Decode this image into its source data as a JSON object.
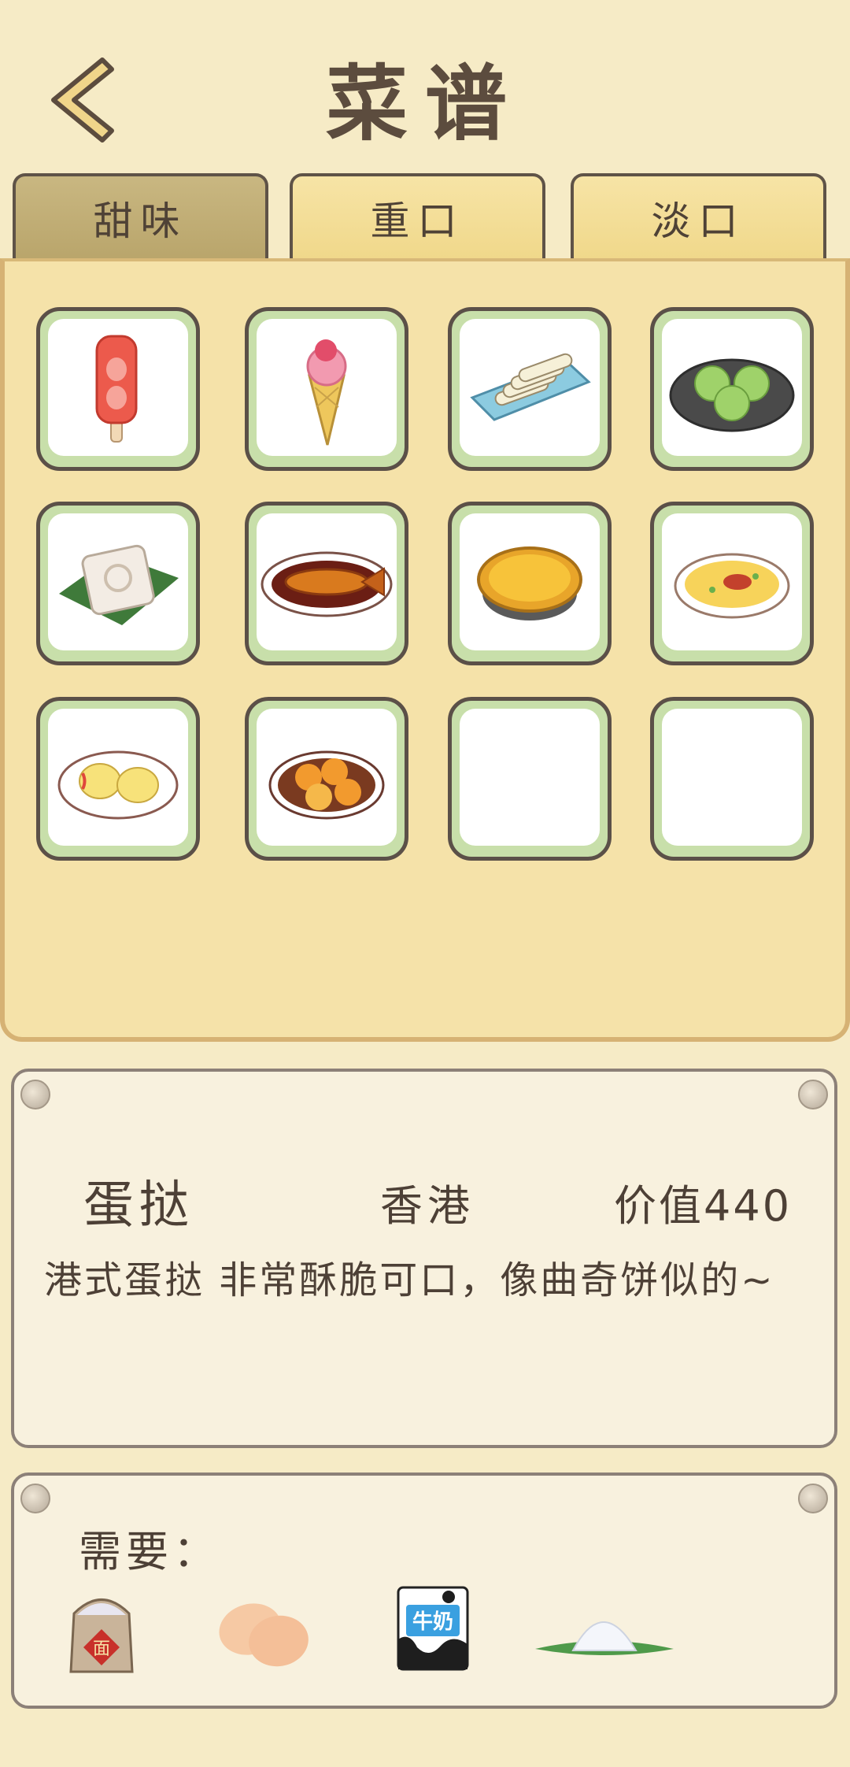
{
  "header": {
    "title": "菜谱"
  },
  "tabs": [
    {
      "label": "甜味",
      "active": true
    },
    {
      "label": "重口",
      "active": false
    },
    {
      "label": "淡口",
      "active": false
    }
  ],
  "recipes": [
    {
      "icon": "strawberry-popsicle-icon"
    },
    {
      "icon": "ice-cream-cone-icon"
    },
    {
      "icon": "rolled-snacks-icon"
    },
    {
      "icon": "green-dumplings-icon"
    },
    {
      "icon": "square-cake-icon"
    },
    {
      "icon": "braised-fish-icon"
    },
    {
      "icon": "egg-tart-icon"
    },
    {
      "icon": "omelette-icon"
    },
    {
      "icon": "pastry-plate-icon"
    },
    {
      "icon": "fried-balls-icon"
    },
    {
      "icon": "empty-slot"
    },
    {
      "icon": "empty-slot"
    }
  ],
  "detail": {
    "name": "蛋挞",
    "origin": "香港",
    "value": "价值440",
    "description": "港式蛋挞 非常酥脆可口，像曲奇饼似的~"
  },
  "requirements": {
    "label": "需要：",
    "items": [
      {
        "icon": "flour-sack-icon",
        "text": "面"
      },
      {
        "icon": "eggs-icon"
      },
      {
        "icon": "milk-carton-icon",
        "text": "牛奶"
      },
      {
        "icon": "sugar-pile-icon"
      }
    ]
  },
  "colors": {
    "background": "#f6ebc6",
    "panel": "#f5e2a9",
    "border": "#5b5048",
    "slot_frame": "#c8dfaa"
  }
}
